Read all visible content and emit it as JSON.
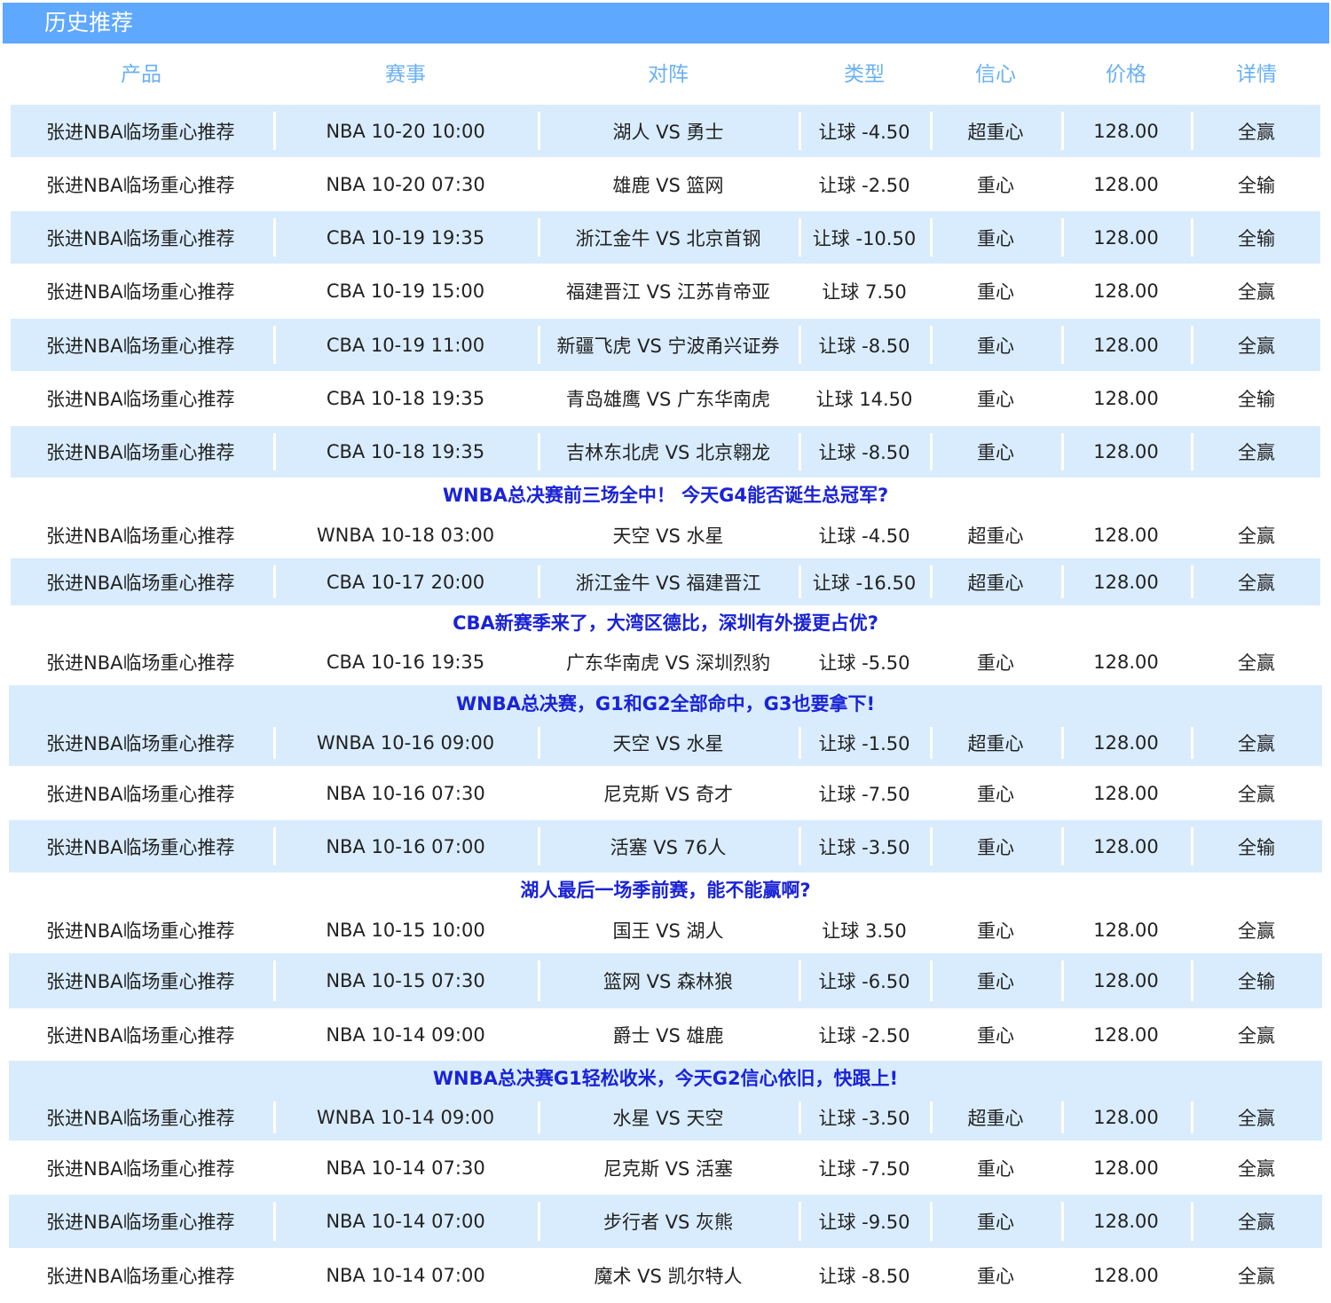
{
  "header": {
    "title": "历史推荐"
  },
  "columns": [
    "产品",
    "赛事",
    "对阵",
    "类型",
    "信心",
    "价格",
    "详情"
  ],
  "rows": [
    {
      "kind": "row",
      "product": "张进NBA临场重心推荐",
      "event": "NBA 10-20 10:00",
      "match": "湖人 VS 勇士",
      "type": "让球 -4.50",
      "confidence": "超重心",
      "price": "128.00",
      "detail": "全赢"
    },
    {
      "kind": "row",
      "product": "张进NBA临场重心推荐",
      "event": "NBA 10-20 07:30",
      "match": "雄鹿 VS 篮网",
      "type": "让球 -2.50",
      "confidence": "重心",
      "price": "128.00",
      "detail": "全输"
    },
    {
      "kind": "row",
      "product": "张进NBA临场重心推荐",
      "event": "CBA 10-19 19:35",
      "match": "浙江金牛 VS 北京首钢",
      "type": "让球 -10.50",
      "confidence": "重心",
      "price": "128.00",
      "detail": "全输"
    },
    {
      "kind": "row",
      "product": "张进NBA临场重心推荐",
      "event": "CBA 10-19 15:00",
      "match": "福建晋江 VS 江苏肯帝亚",
      "type": "让球 7.50",
      "confidence": "重心",
      "price": "128.00",
      "detail": "全赢"
    },
    {
      "kind": "row",
      "product": "张进NBA临场重心推荐",
      "event": "CBA 10-19 11:00",
      "match": "新疆飞虎 VS 宁波甬兴证券",
      "type": "让球 -8.50",
      "confidence": "重心",
      "price": "128.00",
      "detail": "全赢"
    },
    {
      "kind": "row",
      "product": "张进NBA临场重心推荐",
      "event": "CBA 10-18 19:35",
      "match": "青岛雄鹰 VS 广东华南虎",
      "type": "让球 14.50",
      "confidence": "重心",
      "price": "128.00",
      "detail": "全输"
    },
    {
      "kind": "row",
      "product": "张进NBA临场重心推荐",
      "event": "CBA 10-18 19:35",
      "match": "吉林东北虎 VS 北京翱龙",
      "type": "让球 -8.50",
      "confidence": "重心",
      "price": "128.00",
      "detail": "全赢"
    },
    {
      "kind": "promo",
      "text": "WNBA总决赛前三场全中！ 今天G4能否诞生总冠军?"
    },
    {
      "kind": "row",
      "product": "张进NBA临场重心推荐",
      "event": "WNBA 10-18 03:00",
      "match": "天空 VS 水星",
      "type": "让球 -4.50",
      "confidence": "超重心",
      "price": "128.00",
      "detail": "全赢"
    },
    {
      "kind": "row",
      "product": "张进NBA临场重心推荐",
      "event": "CBA 10-17 20:00",
      "match": "浙江金牛 VS 福建晋江",
      "type": "让球 -16.50",
      "confidence": "超重心",
      "price": "128.00",
      "detail": "全赢"
    },
    {
      "kind": "promo",
      "text": "CBA新赛季来了，大湾区德比，深圳有外援更占优?"
    },
    {
      "kind": "row",
      "product": "张进NBA临场重心推荐",
      "event": "CBA 10-16 19:35",
      "match": "广东华南虎 VS 深圳烈豹",
      "type": "让球 -5.50",
      "confidence": "重心",
      "price": "128.00",
      "detail": "全赢"
    },
    {
      "kind": "promo",
      "text": "WNBA总决赛，G1和G2全部命中，G3也要拿下!"
    },
    {
      "kind": "row",
      "product": "张进NBA临场重心推荐",
      "event": "WNBA 10-16 09:00",
      "match": "天空 VS 水星",
      "type": "让球 -1.50",
      "confidence": "超重心",
      "price": "128.00",
      "detail": "全赢"
    },
    {
      "kind": "row",
      "product": "张进NBA临场重心推荐",
      "event": "NBA 10-16 07:30",
      "match": "尼克斯 VS 奇才",
      "type": "让球 -7.50",
      "confidence": "重心",
      "price": "128.00",
      "detail": "全赢"
    },
    {
      "kind": "row",
      "product": "张进NBA临场重心推荐",
      "event": "NBA 10-16 07:00",
      "match": "活塞 VS 76人",
      "type": "让球 -3.50",
      "confidence": "重心",
      "price": "128.00",
      "detail": "全输"
    },
    {
      "kind": "promo",
      "text": "湖人最后一场季前赛，能不能赢啊?"
    },
    {
      "kind": "row",
      "product": "张进NBA临场重心推荐",
      "event": "NBA 10-15 10:00",
      "match": "国王 VS 湖人",
      "type": "让球 3.50",
      "confidence": "重心",
      "price": "128.00",
      "detail": "全赢"
    },
    {
      "kind": "row",
      "product": "张进NBA临场重心推荐",
      "event": "NBA 10-15 07:30",
      "match": "篮网 VS 森林狼",
      "type": "让球 -6.50",
      "confidence": "重心",
      "price": "128.00",
      "detail": "全输"
    },
    {
      "kind": "row",
      "product": "张进NBA临场重心推荐",
      "event": "NBA 10-14 09:00",
      "match": "爵士 VS 雄鹿",
      "type": "让球 -2.50",
      "confidence": "重心",
      "price": "128.00",
      "detail": "全赢"
    },
    {
      "kind": "promo",
      "text": "WNBA总决赛G1轻松收米，今天G2信心依旧，快跟上!"
    },
    {
      "kind": "row",
      "product": "张进NBA临场重心推荐",
      "event": "WNBA 10-14 09:00",
      "match": "水星 VS 天空",
      "type": "让球 -3.50",
      "confidence": "超重心",
      "price": "128.00",
      "detail": "全赢"
    },
    {
      "kind": "row",
      "product": "张进NBA临场重心推荐",
      "event": "NBA 10-14 07:30",
      "match": "尼克斯 VS 活塞",
      "type": "让球 -7.50",
      "confidence": "重心",
      "price": "128.00",
      "detail": "全赢"
    },
    {
      "kind": "row",
      "product": "张进NBA临场重心推荐",
      "event": "NBA 10-14 07:00",
      "match": "步行者 VS 灰熊",
      "type": "让球 -9.50",
      "confidence": "重心",
      "price": "128.00",
      "detail": "全赢"
    },
    {
      "kind": "row",
      "product": "张进NBA临场重心推荐",
      "event": "NBA 10-14 07:00",
      "match": "魔术 VS 凯尔特人",
      "type": "让球 -8.50",
      "confidence": "重心",
      "price": "128.00",
      "detail": "全赢"
    }
  ],
  "colors": {
    "header_bg": "#5ea8ff",
    "row_stripe": "#d9ecfd",
    "column_head_text": "#6ab0f4",
    "promo_text": "#1a23d6"
  }
}
